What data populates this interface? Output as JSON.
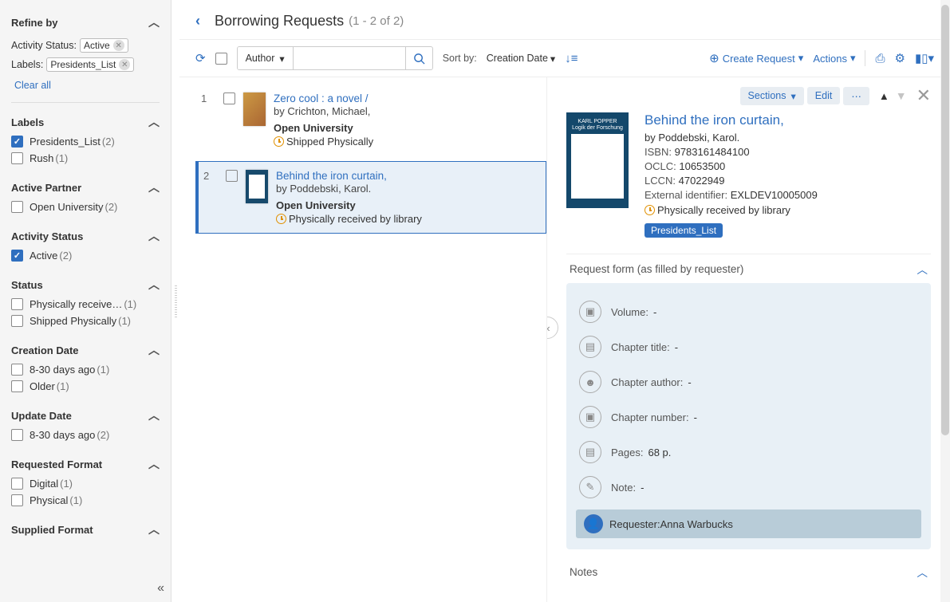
{
  "facets": {
    "refine_by": "Refine by",
    "activity_status_label": "Activity Status:",
    "activity_status_value": "Active",
    "labels_label": "Labels:",
    "labels_value": "Presidents_List",
    "clear_all": "Clear all",
    "labels_section": "Labels",
    "labels_items": [
      {
        "name": "Presidents_List",
        "count": "(2)",
        "checked": true
      },
      {
        "name": "Rush",
        "count": "(1)",
        "checked": false
      }
    ],
    "active_partner_section": "Active Partner",
    "active_partner_items": [
      {
        "name": "Open University",
        "count": "(2)",
        "checked": false
      }
    ],
    "activity_status_section": "Activity Status",
    "activity_status_items": [
      {
        "name": "Active",
        "count": "(2)",
        "checked": true
      }
    ],
    "status_section": "Status",
    "status_items": [
      {
        "name": "Physically receive…",
        "count": "(1)",
        "checked": false
      },
      {
        "name": "Shipped Physically",
        "count": "(1)",
        "checked": false
      }
    ],
    "creation_date_section": "Creation Date",
    "creation_date_items": [
      {
        "name": "8-30 days ago",
        "count": "(1)",
        "checked": false
      },
      {
        "name": "Older",
        "count": "(1)",
        "checked": false
      }
    ],
    "update_date_section": "Update Date",
    "update_date_items": [
      {
        "name": "8-30 days ago",
        "count": "(2)",
        "checked": false
      }
    ],
    "requested_format_section": "Requested Format",
    "requested_format_items": [
      {
        "name": "Digital",
        "count": "(1)",
        "checked": false
      },
      {
        "name": "Physical",
        "count": "(1)",
        "checked": false
      }
    ],
    "supplied_format_section": "Supplied Format"
  },
  "header": {
    "title": "Borrowing Requests",
    "range": "(1 - 2 of 2)"
  },
  "toolbar": {
    "search_field": "Author",
    "sort_label": "Sort by:",
    "sort_value": "Creation Date",
    "create_request": "Create Request",
    "actions": "Actions"
  },
  "records": [
    {
      "num": "1",
      "title": "Zero cool : a novel /",
      "by": "by",
      "author": "Crichton, Michael,",
      "institution": "Open University",
      "status": "Shipped Physically"
    },
    {
      "num": "2",
      "title": "Behind the iron curtain,",
      "by": "by",
      "author": "Poddebski, Karol.",
      "institution": "Open University",
      "status": "Physically received by library"
    }
  ],
  "detail": {
    "sections_btn": "Sections",
    "edit_btn": "Edit",
    "thumb_line1": "KARL POPPER",
    "thumb_line2": "Logik der Forschung",
    "title": "Behind the iron curtain,",
    "by": "by",
    "author": "Poddebski, Karol.",
    "isbn_label": "ISBN:",
    "isbn": "9783161484100",
    "oclc_label": "OCLC:",
    "oclc": "10653500",
    "lccn_label": "LCCN:",
    "lccn": "47022949",
    "ext_label": "External identifier:",
    "ext": "EXLDEV10005009",
    "status": "Physically received by library",
    "label_tag": "Presidents_List",
    "request_form_hdr": "Request form (as filled by requester)",
    "form": {
      "volume_l": "Volume:",
      "volume_v": "-",
      "chtitle_l": "Chapter title:",
      "chtitle_v": "-",
      "chauthor_l": "Chapter author:",
      "chauthor_v": "-",
      "chnum_l": "Chapter number:",
      "chnum_v": "-",
      "pages_l": "Pages:",
      "pages_v": "68 p.",
      "note_l": "Note:",
      "note_v": "-",
      "requester_l": "Requester:",
      "requester_v": "Anna Warbucks"
    },
    "notes_hdr": "Notes"
  }
}
